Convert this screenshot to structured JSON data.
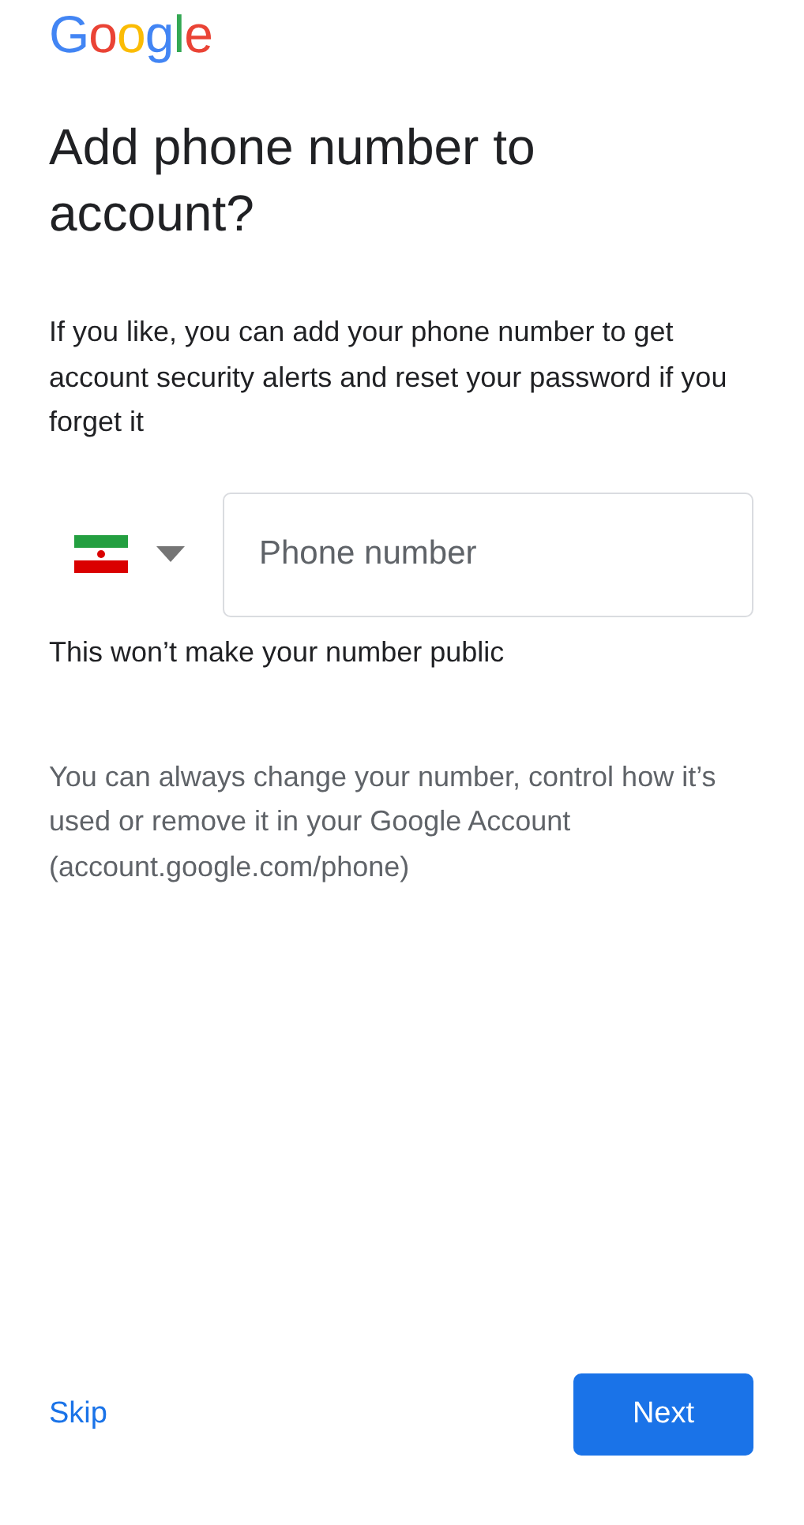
{
  "logo": "Google",
  "title": "Add phone number to account?",
  "intro": "If you like, you can add your phone number to get account security alerts and reset your password if you forget it",
  "phone": {
    "placeholder": "Phone number"
  },
  "public_note": "This won’t make your number public",
  "info": "You can always change your number, control how it’s used or remove it in your Google Account (account.google.com/phone)",
  "actions": {
    "skip": "Skip",
    "next": "Next"
  }
}
